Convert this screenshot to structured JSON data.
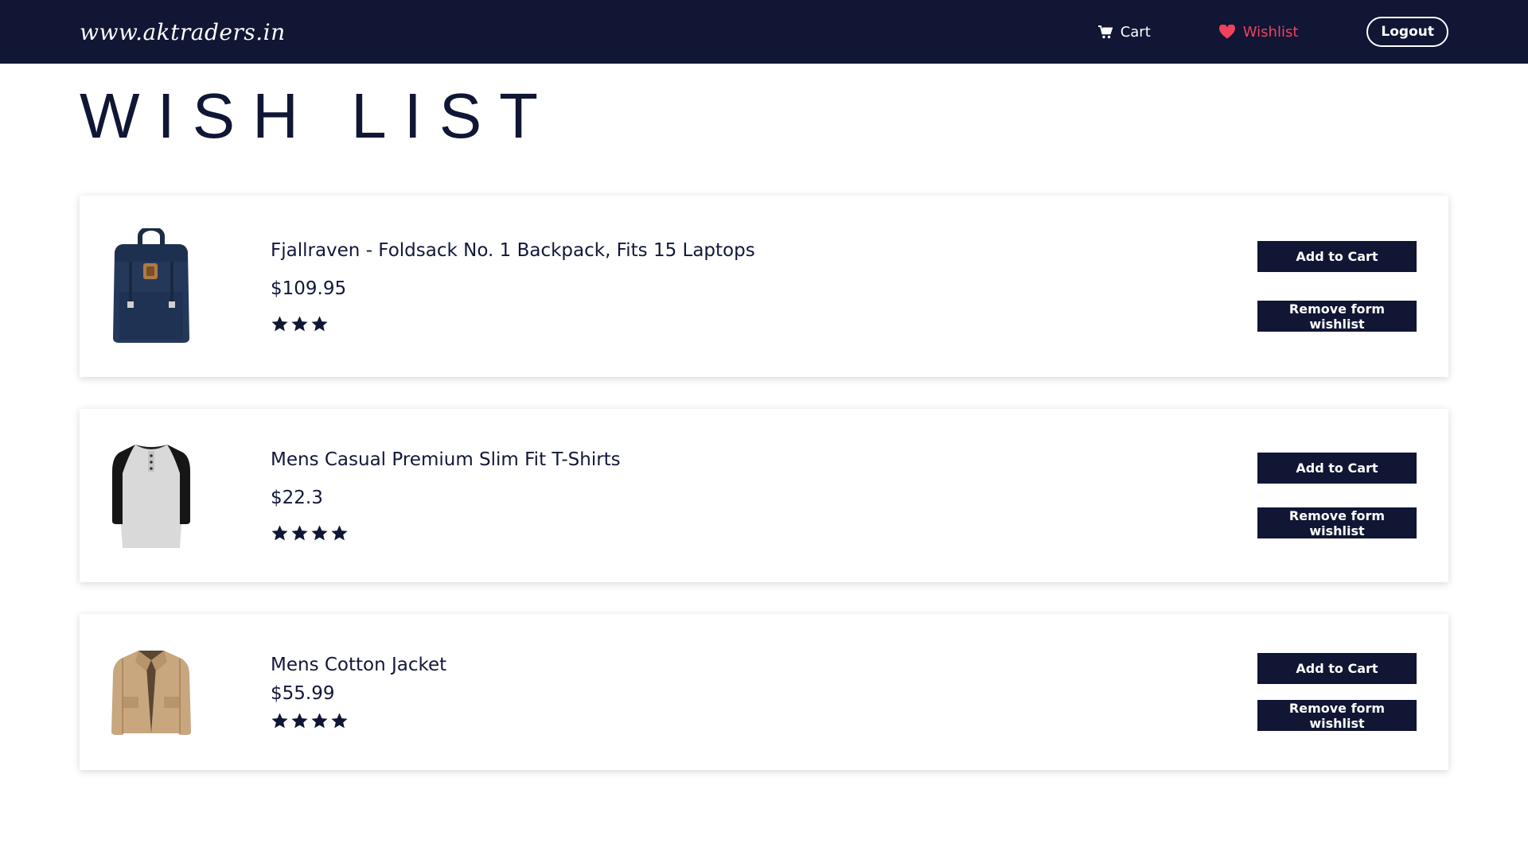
{
  "header": {
    "brand": "www.aktraders.in",
    "cart_label": "Cart",
    "wishlist_label": "Wishlist",
    "logout_label": "Logout"
  },
  "page": {
    "title": "WISH LIST"
  },
  "items": [
    {
      "title": "Fjallraven - Foldsack No. 1 Backpack, Fits 15 Laptops",
      "price": "$109.95",
      "rating": 3,
      "image": "backpack-image",
      "add_label": "Add to Cart",
      "remove_label": "Remove form wishlist"
    },
    {
      "title": "Mens Casual Premium Slim Fit T-Shirts",
      "price": "$22.3",
      "rating": 4,
      "image": "tshirt-image",
      "add_label": "Add to Cart",
      "remove_label": "Remove form wishlist"
    },
    {
      "title": "Mens Cotton Jacket",
      "price": "$55.99",
      "rating": 4,
      "image": "jacket-image",
      "add_label": "Add to Cart",
      "remove_label": "Remove form wishlist"
    }
  ],
  "colors": {
    "navbar": "#101634",
    "accent": "#f0415f",
    "button": "#101634"
  }
}
